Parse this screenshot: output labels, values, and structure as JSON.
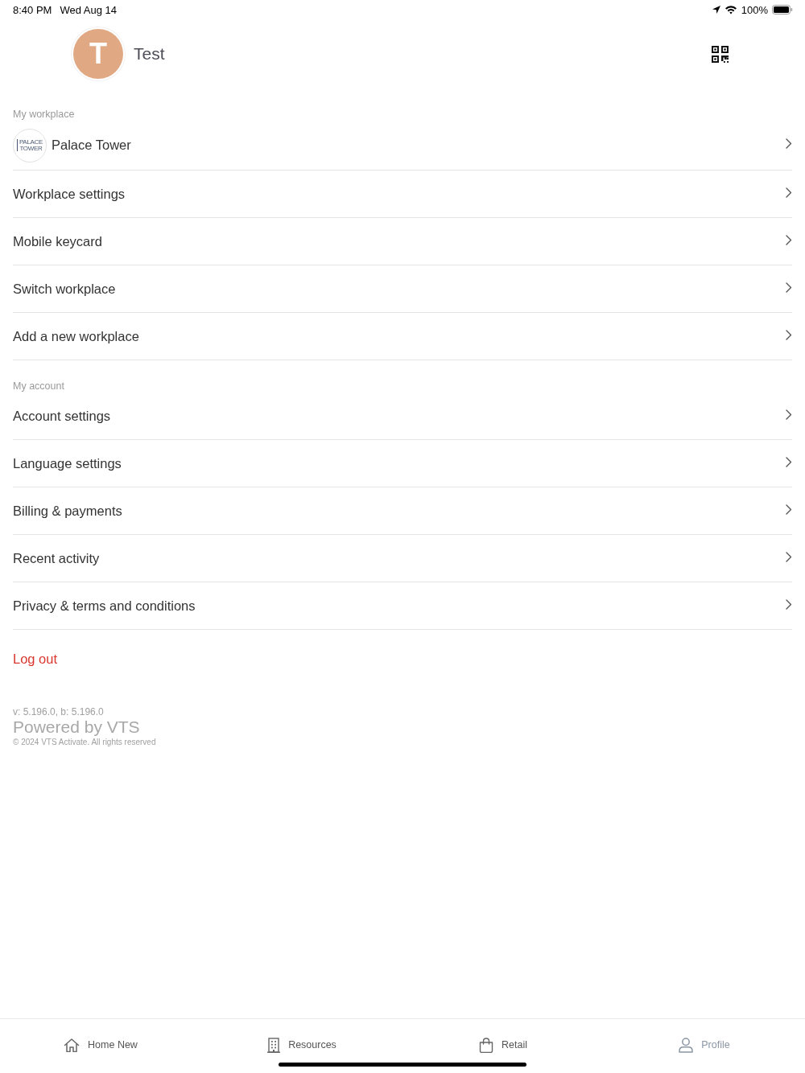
{
  "status_bar": {
    "time": "8:40 PM",
    "date": "Wed Aug 14",
    "battery": "100%"
  },
  "header": {
    "avatar_initial": "T",
    "name": "Test"
  },
  "sections": [
    {
      "title": "My workplace",
      "items": [
        {
          "kind": "workplace",
          "label": "Palace Tower",
          "logo_text": "PALACE TOWER"
        },
        {
          "kind": "link",
          "label": "Workplace settings"
        },
        {
          "kind": "link",
          "label": "Mobile keycard"
        },
        {
          "kind": "link",
          "label": "Switch workplace"
        },
        {
          "kind": "link",
          "label": "Add a new workplace"
        }
      ]
    },
    {
      "title": "My account",
      "items": [
        {
          "kind": "link",
          "label": "Account settings"
        },
        {
          "kind": "link",
          "label": "Language settings"
        },
        {
          "kind": "link",
          "label": "Billing & payments"
        },
        {
          "kind": "link",
          "label": "Recent activity"
        },
        {
          "kind": "link",
          "label": "Privacy & terms and conditions"
        }
      ]
    }
  ],
  "logout": "Log out",
  "footer": {
    "version": "v: 5.196.0, b: 5.196.0",
    "powered_by": "Powered by VTS",
    "copyright": "© 2024 VTS Activate. All rights reserved"
  },
  "tab_bar": [
    {
      "label": "Home New",
      "selected": false
    },
    {
      "label": "Resources",
      "selected": false
    },
    {
      "label": "Retail",
      "selected": false
    },
    {
      "label": "Profile",
      "selected": true
    }
  ]
}
